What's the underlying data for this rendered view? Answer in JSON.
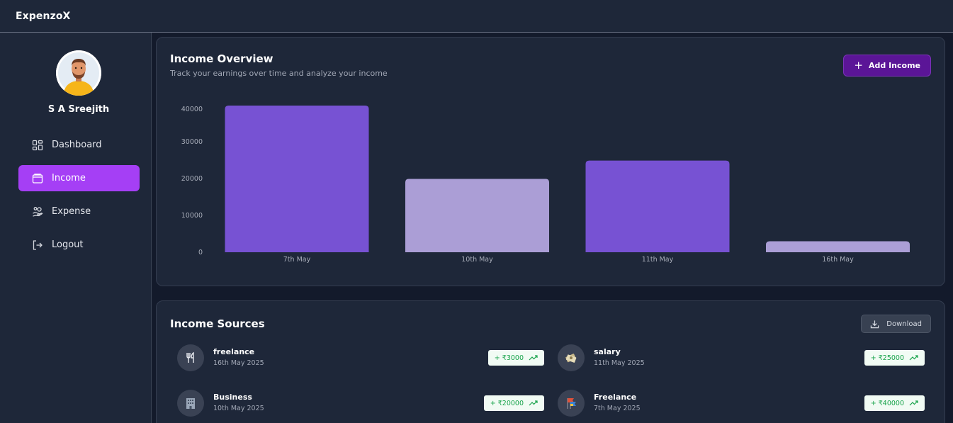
{
  "app": {
    "title": "ExpenzoX"
  },
  "user": {
    "name": "S A Sreejith"
  },
  "sidebar": {
    "items": [
      {
        "label": "Dashboard",
        "icon": "dashboard-grid-icon",
        "active": false
      },
      {
        "label": "Income",
        "icon": "wallet-icon",
        "active": true
      },
      {
        "label": "Expense",
        "icon": "hand-coins-icon",
        "active": false
      },
      {
        "label": "Logout",
        "icon": "logout-icon",
        "active": false
      }
    ]
  },
  "overview": {
    "title": "Income Overview",
    "subtitle": "Track your earnings over time and analyze your income",
    "add_button": "Add Income"
  },
  "chart_data": {
    "type": "bar",
    "categories": [
      "7th May",
      "10th May",
      "11th May",
      "16th May"
    ],
    "values": [
      40000,
      20000,
      25000,
      3000
    ],
    "ylim": [
      0,
      40000
    ],
    "yticks": [
      0,
      10000,
      20000,
      30000,
      40000
    ],
    "bar_colors": [
      "#7752d3",
      "#ab9ed6",
      "#7752d3",
      "#ab9ed6"
    ],
    "grid": false
  },
  "sources": {
    "title": "Income Sources",
    "download_button": "Download",
    "items": [
      {
        "name": "freelance",
        "date": "16th May 2025",
        "amount": "+ ₹3000",
        "icon": "fork-knife-icon"
      },
      {
        "name": "salary",
        "date": "11th May 2025",
        "amount": "+ ₹25000",
        "icon": "money-icon"
      },
      {
        "name": "Business",
        "date": "10th May 2025",
        "amount": "+ ₹20000",
        "icon": "office-building-icon"
      },
      {
        "name": "Freelance",
        "date": "7th May 2025",
        "amount": "+ ₹40000",
        "icon": "flags-icon"
      }
    ]
  }
}
